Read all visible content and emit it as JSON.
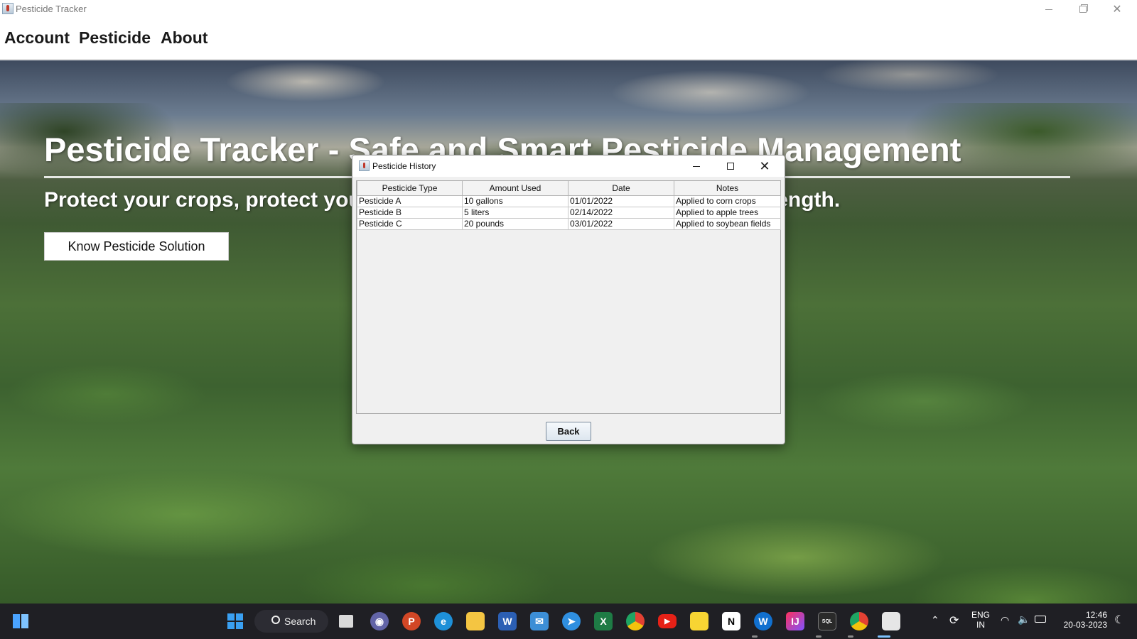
{
  "window": {
    "title": "Pesticide Tracker"
  },
  "menu": {
    "items": [
      "Account",
      "Pesticide",
      "About"
    ]
  },
  "hero": {
    "title": "Pesticide Tracker - Safe and Smart Pesticide Management",
    "subtitle": "Protect your crops, protect your future: pesticide management is our strength.",
    "button_label": "Know Pesticide Solution"
  },
  "dialog": {
    "title": "Pesticide History",
    "columns": [
      "Pesticide Type",
      "Amount Used",
      "Date",
      "Notes"
    ],
    "rows": [
      [
        "Pesticide A",
        "10 gallons",
        "01/01/2022",
        "Applied to corn crops"
      ],
      [
        "Pesticide B",
        "5 liters",
        "02/14/2022",
        "Applied to apple trees"
      ],
      [
        "Pesticide C",
        "20 pounds",
        "03/01/2022",
        "Applied to soybean fields"
      ]
    ],
    "back_label": "Back"
  },
  "taskbar": {
    "search_label": "Search",
    "language": "ENG",
    "region": "IN",
    "time": "12:46",
    "date": "20-03-2023",
    "apps": [
      "windows-start",
      "task-view",
      "teams",
      "powerpoint",
      "edge",
      "file-explorer",
      "word",
      "mail",
      "safari",
      "excel",
      "chrome",
      "youtube",
      "sticky-notes",
      "notion",
      "webex",
      "intellij",
      "mysql",
      "chrome-profile",
      "java-app"
    ]
  },
  "colors": {
    "taskbar_bg": "#1f1f24",
    "dialog_bg": "#f0f0f0",
    "accent": "#4aa3ff"
  }
}
